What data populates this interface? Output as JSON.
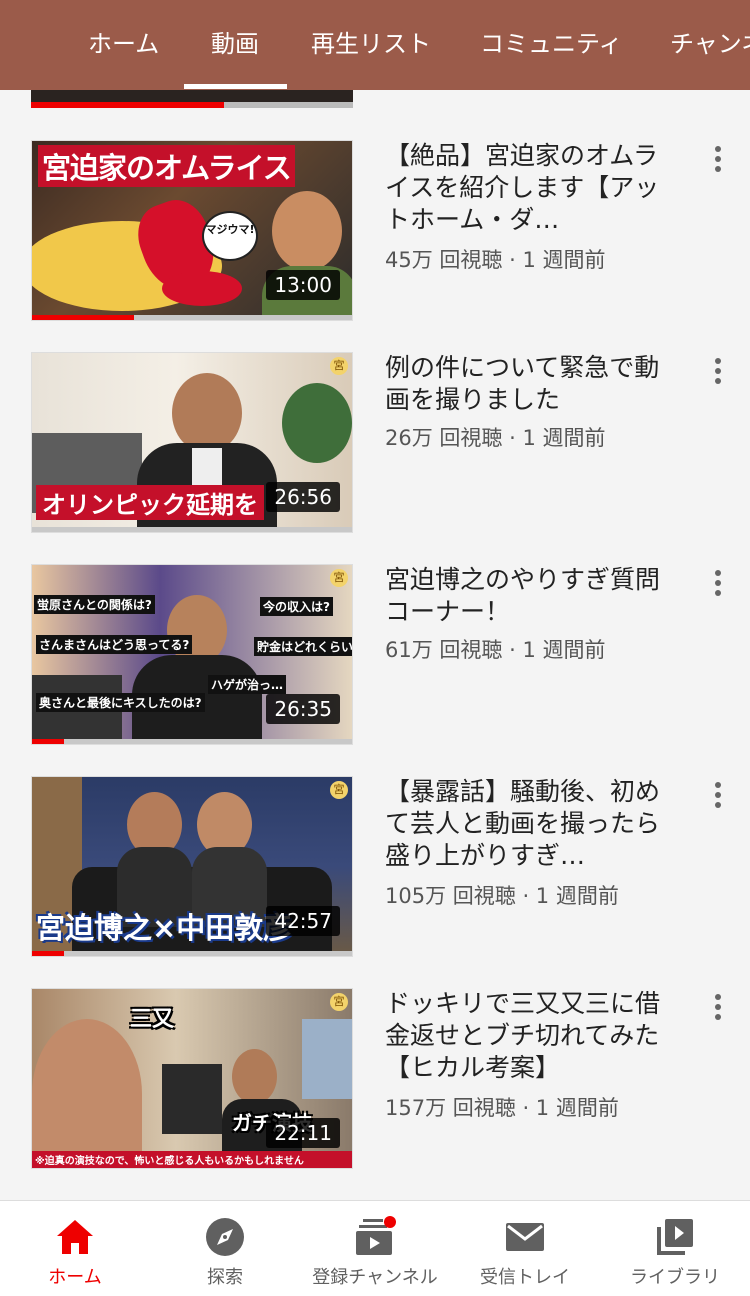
{
  "tabs": [
    "ホーム",
    "動画",
    "再生リスト",
    "コミュニティ",
    "チャンネル"
  ],
  "active_tab": 1,
  "partial_video": {
    "progress_pct": 60
  },
  "videos": [
    {
      "title": "【絶品】宮迫家のオムライスを紹介します【アットホーム・ダ…",
      "views": "45万 回視聴",
      "age": "1 週間前",
      "duration": "13:00",
      "progress_pct": 32,
      "thumb_text": "宮迫家のオムライス",
      "thumb_sticker": "マジウマ!"
    },
    {
      "title": "例の件について緊急で動画を撮りました",
      "views": "26万 回視聴",
      "age": "1 週間前",
      "duration": "26:56",
      "progress_pct": 0,
      "thumb_text": "オリンピック延期を"
    },
    {
      "title": "宮迫博之のやりすぎ質問コーナー！",
      "views": "61万 回視聴",
      "age": "1 週間前",
      "duration": "26:35",
      "progress_pct": 10,
      "thumb_bubbles": [
        "蛍原さんとの関係は?",
        "今の収入は?",
        "さんまさんはどう思ってる?",
        "貯金はどれくらい?",
        "奥さんと最後にキスしたのは?",
        "ハゲが治っ…"
      ]
    },
    {
      "title": "【暴露話】騒動後、初めて芸人と動画を撮ったら盛り上がりすぎ…",
      "views": "105万 回視聴",
      "age": "1 週間前",
      "duration": "42:57",
      "progress_pct": 10,
      "thumb_text": "宮迫博之×中田敦彦"
    },
    {
      "title": "ドッキリで三又又三に借金返せとブチ切れてみた【ヒカル考案】",
      "views": "157万 回視聴",
      "age": "1 週間前",
      "duration": "22:11",
      "progress_pct": 0,
      "thumb_text_1": "三又",
      "thumb_text_2": "ガチ演技",
      "thumb_caption": "※迫真の演技なので、怖いと感じる人もいるかもしれません"
    }
  ],
  "nav": [
    {
      "label": "ホーム",
      "icon": "home-icon",
      "active": true
    },
    {
      "label": "探索",
      "icon": "compass-icon",
      "active": false
    },
    {
      "label": "登録チャンネル",
      "icon": "subscriptions-icon",
      "active": false
    },
    {
      "label": "受信トレイ",
      "icon": "inbox-icon",
      "active": false
    },
    {
      "label": "ライブラリ",
      "icon": "library-icon",
      "active": false
    }
  ],
  "colors": {
    "header_bg": "#9b5b4a",
    "accent": "#e00000"
  }
}
